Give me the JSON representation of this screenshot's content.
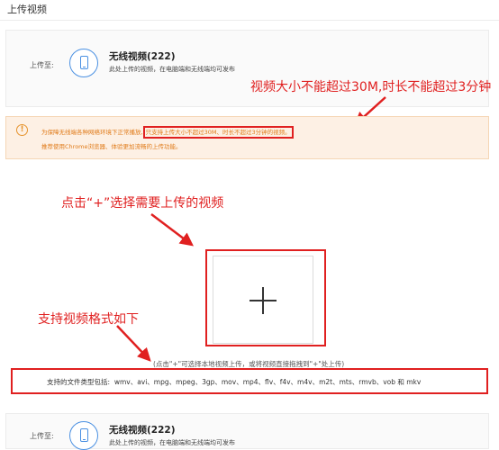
{
  "page": {
    "title": "上传视频"
  },
  "upload_target": {
    "label": "上传至:",
    "category_name": "无线视频(222)",
    "category_desc": "此处上传的视频，在电脑端和无线端均可发布"
  },
  "notice": {
    "icon": "warning-circle-icon",
    "line1_prefix": "为保障无线端各种网络环境下正常播放,",
    "line1_highlight": "只支持上传大小不超过30M、时长不超过3分钟的视频。",
    "line2": "推荐使用Chrome浏览器、体验更加流畅的上传功能。"
  },
  "uploader": {
    "plus_icon": "plus-icon",
    "hint": "(点击\"+\"可选择本地视频上传，或将视频直接拖拽到\"+\"处上传)",
    "formats_label": "支持的文件类型包括:",
    "formats": "wmv、avi、mpg、mpeg、3gp、mov、mp4、flv、f4v、m4v、m2t、mts、rmvb、vob 和 mkv"
  },
  "annotations": {
    "size_limit": "视频大小不能超过30M,时长不能超过3分钟",
    "click_plus": "点击“+”选择需要上传的视频",
    "supported_formats": "支持视频格式如下",
    "color": "#e02020"
  },
  "upload_target_2": {
    "label": "上传至:",
    "category_name": "无线视频(222)",
    "category_desc": "此处上传的视频，在电脑端和无线端均可发布"
  }
}
